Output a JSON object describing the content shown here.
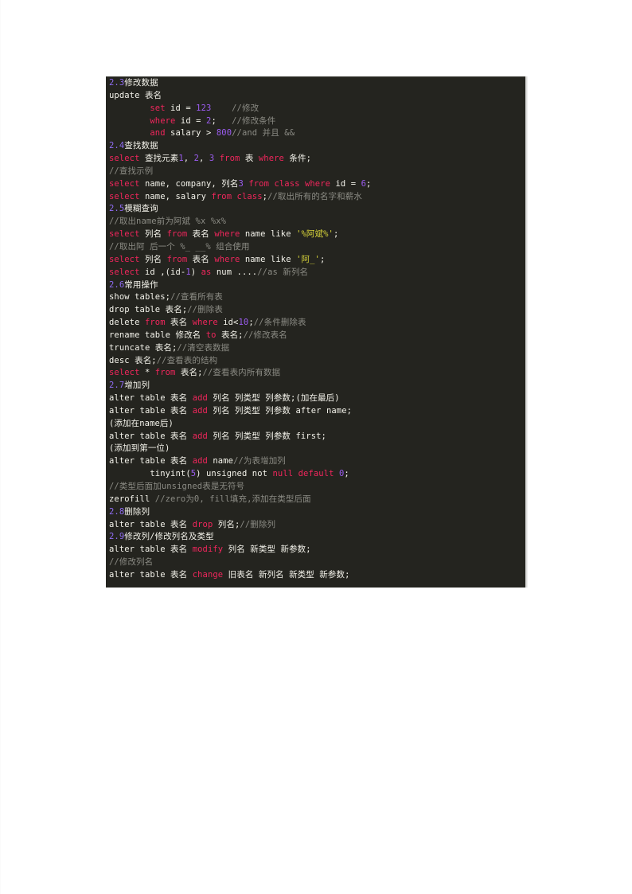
{
  "document": {
    "kind": "scanned-document-page",
    "background_color": "#ffffff",
    "code_block": {
      "background_color": "#24241f",
      "language": "sql",
      "colors": {
        "keyword": "#f0265c",
        "identifier": "#f3f2ea",
        "number": "#9b5cf0",
        "string": "#d6d23a",
        "comment": "#8b8b84",
        "section": "#8f6cf2"
      },
      "lines": [
        {
          "id": "l01",
          "tokens": [
            {
              "t": "2.3",
              "c": "sec"
            },
            {
              "t": "修改数据",
              "c": "id"
            }
          ]
        },
        {
          "id": "l02",
          "tokens": [
            {
              "t": "update",
              "c": "id"
            },
            {
              "t": " 表名",
              "c": "id"
            }
          ]
        },
        {
          "id": "l03",
          "tokens": [
            {
              "t": "        ",
              "c": "op"
            },
            {
              "t": "set",
              "c": "kw"
            },
            {
              "t": " id ",
              "c": "id"
            },
            {
              "t": "=",
              "c": "id"
            },
            {
              "t": " ",
              "c": "id"
            },
            {
              "t": "123",
              "c": "num"
            },
            {
              "t": "    ",
              "c": "op"
            },
            {
              "t": "//修改",
              "c": "cmt"
            }
          ]
        },
        {
          "id": "l04",
          "tokens": [
            {
              "t": "        ",
              "c": "op"
            },
            {
              "t": "where",
              "c": "kw"
            },
            {
              "t": " id ",
              "c": "id"
            },
            {
              "t": "=",
              "c": "id"
            },
            {
              "t": " ",
              "c": "id"
            },
            {
              "t": "2",
              "c": "num"
            },
            {
              "t": ";",
              "c": "id"
            },
            {
              "t": "   ",
              "c": "op"
            },
            {
              "t": "//修改条件",
              "c": "cmt"
            }
          ]
        },
        {
          "id": "l05",
          "tokens": [
            {
              "t": "        ",
              "c": "op"
            },
            {
              "t": "and",
              "c": "kw"
            },
            {
              "t": " salary ",
              "c": "id"
            },
            {
              "t": ">",
              "c": "id"
            },
            {
              "t": " ",
              "c": "id"
            },
            {
              "t": "800",
              "c": "num"
            },
            {
              "t": "//and 并且 &&",
              "c": "cmt"
            }
          ]
        },
        {
          "id": "l06",
          "tokens": [
            {
              "t": "2.4",
              "c": "sec"
            },
            {
              "t": "查找数据",
              "c": "id"
            }
          ]
        },
        {
          "id": "l07",
          "tokens": [
            {
              "t": "select",
              "c": "kw"
            },
            {
              "t": " 查找元素",
              "c": "id"
            },
            {
              "t": "1",
              "c": "num"
            },
            {
              "t": ", ",
              "c": "id"
            },
            {
              "t": "2",
              "c": "num"
            },
            {
              "t": ", ",
              "c": "id"
            },
            {
              "t": "3",
              "c": "num"
            },
            {
              "t": " ",
              "c": "id"
            },
            {
              "t": "from",
              "c": "kw"
            },
            {
              "t": " 表 ",
              "c": "id"
            },
            {
              "t": "where",
              "c": "kw"
            },
            {
              "t": " 条件;",
              "c": "id"
            }
          ]
        },
        {
          "id": "l08",
          "tokens": [
            {
              "t": "//查找示例",
              "c": "cmt"
            }
          ]
        },
        {
          "id": "l09",
          "tokens": [
            {
              "t": "select",
              "c": "kw"
            },
            {
              "t": " name, company, 列名",
              "c": "id"
            },
            {
              "t": "3",
              "c": "num"
            },
            {
              "t": " ",
              "c": "id"
            },
            {
              "t": "from",
              "c": "kw"
            },
            {
              "t": " ",
              "c": "id"
            },
            {
              "t": "class",
              "c": "kw"
            },
            {
              "t": " ",
              "c": "id"
            },
            {
              "t": "where",
              "c": "kw"
            },
            {
              "t": " id = ",
              "c": "id"
            },
            {
              "t": "6",
              "c": "num"
            },
            {
              "t": ";",
              "c": "id"
            }
          ]
        },
        {
          "id": "l10",
          "tokens": [
            {
              "t": "select",
              "c": "kw"
            },
            {
              "t": " name, salary ",
              "c": "id"
            },
            {
              "t": "from",
              "c": "kw"
            },
            {
              "t": " ",
              "c": "id"
            },
            {
              "t": "class",
              "c": "kw"
            },
            {
              "t": ";",
              "c": "id"
            },
            {
              "t": "//取出所有的名字和薪水",
              "c": "cmt"
            }
          ]
        },
        {
          "id": "l11",
          "tokens": [
            {
              "t": "2.5",
              "c": "sec"
            },
            {
              "t": "模糊查询",
              "c": "id"
            }
          ]
        },
        {
          "id": "l12",
          "tokens": [
            {
              "t": "//取出name前为阿斌 %x %x%",
              "c": "cmt"
            }
          ]
        },
        {
          "id": "l13",
          "tokens": [
            {
              "t": "select",
              "c": "kw"
            },
            {
              "t": " 列名 ",
              "c": "id"
            },
            {
              "t": "from",
              "c": "kw"
            },
            {
              "t": " 表名 ",
              "c": "id"
            },
            {
              "t": "where",
              "c": "kw"
            },
            {
              "t": " name like ",
              "c": "id"
            },
            {
              "t": "'%阿斌%'",
              "c": "str"
            },
            {
              "t": ";",
              "c": "id"
            }
          ]
        },
        {
          "id": "l14",
          "tokens": [
            {
              "t": "//取出阿 后一个 %_ __% 组合使用",
              "c": "cmt"
            }
          ]
        },
        {
          "id": "l15",
          "tokens": [
            {
              "t": "select",
              "c": "kw"
            },
            {
              "t": " 列名 ",
              "c": "id"
            },
            {
              "t": "from",
              "c": "kw"
            },
            {
              "t": " 表名 ",
              "c": "id"
            },
            {
              "t": "where",
              "c": "kw"
            },
            {
              "t": " name like ",
              "c": "id"
            },
            {
              "t": "'阿_'",
              "c": "str"
            },
            {
              "t": ";",
              "c": "id"
            }
          ]
        },
        {
          "id": "l16",
          "tokens": [
            {
              "t": "select",
              "c": "kw"
            },
            {
              "t": " id ,(id-",
              "c": "id"
            },
            {
              "t": "1",
              "c": "num"
            },
            {
              "t": ") ",
              "c": "id"
            },
            {
              "t": "as",
              "c": "kw"
            },
            {
              "t": " num ....",
              "c": "id"
            },
            {
              "t": "//as 新列名",
              "c": "cmt"
            }
          ]
        },
        {
          "id": "l17",
          "tokens": [
            {
              "t": "2.6",
              "c": "sec"
            },
            {
              "t": "常用操作",
              "c": "id"
            }
          ]
        },
        {
          "id": "l18",
          "tokens": [
            {
              "t": "show tables;",
              "c": "id"
            },
            {
              "t": "//查看所有表",
              "c": "cmt"
            }
          ]
        },
        {
          "id": "l19",
          "tokens": [
            {
              "t": "drop table 表名;",
              "c": "id"
            },
            {
              "t": "//删除表",
              "c": "cmt"
            }
          ]
        },
        {
          "id": "l20",
          "tokens": [
            {
              "t": "delete",
              "c": "id"
            },
            {
              "t": " ",
              "c": "id"
            },
            {
              "t": "from",
              "c": "kw"
            },
            {
              "t": " 表名 ",
              "c": "id"
            },
            {
              "t": "where",
              "c": "kw"
            },
            {
              "t": " id<",
              "c": "id"
            },
            {
              "t": "10",
              "c": "num"
            },
            {
              "t": ";",
              "c": "id"
            },
            {
              "t": "//条件删除表",
              "c": "cmt"
            }
          ]
        },
        {
          "id": "l21",
          "tokens": [
            {
              "t": "rename table 修改名 ",
              "c": "id"
            },
            {
              "t": "to",
              "c": "kw"
            },
            {
              "t": " 表名;",
              "c": "id"
            },
            {
              "t": "//修改表名",
              "c": "cmt"
            }
          ]
        },
        {
          "id": "l22",
          "tokens": [
            {
              "t": "truncate 表名;",
              "c": "id"
            },
            {
              "t": "//清空表数据",
              "c": "cmt"
            }
          ]
        },
        {
          "id": "l23",
          "tokens": [
            {
              "t": "desc 表名;",
              "c": "id"
            },
            {
              "t": "//查看表的结构",
              "c": "cmt"
            }
          ]
        },
        {
          "id": "l24",
          "tokens": [
            {
              "t": "select",
              "c": "kw"
            },
            {
              "t": " * ",
              "c": "id"
            },
            {
              "t": "from",
              "c": "kw"
            },
            {
              "t": " 表名;",
              "c": "id"
            },
            {
              "t": "//查看表内所有数据",
              "c": "cmt"
            }
          ]
        },
        {
          "id": "l25",
          "tokens": [
            {
              "t": "2.7",
              "c": "sec"
            },
            {
              "t": "增加列",
              "c": "id"
            }
          ]
        },
        {
          "id": "l26",
          "tokens": [
            {
              "t": "alter table 表名 ",
              "c": "id"
            },
            {
              "t": "add",
              "c": "kw"
            },
            {
              "t": " 列名 列类型 列参数;(加在最后)",
              "c": "id"
            }
          ]
        },
        {
          "id": "l27",
          "tokens": [
            {
              "t": "alter table 表名 ",
              "c": "id"
            },
            {
              "t": "add",
              "c": "kw"
            },
            {
              "t": " 列名 列类型 列参数 after name;",
              "c": "id"
            }
          ]
        },
        {
          "id": "l28",
          "tokens": [
            {
              "t": "(添加在name后)",
              "c": "id"
            }
          ]
        },
        {
          "id": "l29",
          "tokens": [
            {
              "t": "alter table 表名 ",
              "c": "id"
            },
            {
              "t": "add",
              "c": "kw"
            },
            {
              "t": " 列名 列类型 列参数 first;",
              "c": "id"
            }
          ]
        },
        {
          "id": "l30",
          "tokens": [
            {
              "t": "(添加到第一位)",
              "c": "id"
            }
          ]
        },
        {
          "id": "l31",
          "tokens": [
            {
              "t": "alter table 表名 ",
              "c": "id"
            },
            {
              "t": "add",
              "c": "kw"
            },
            {
              "t": " name",
              "c": "id"
            },
            {
              "t": "//为表增加列",
              "c": "cmt"
            }
          ]
        },
        {
          "id": "l32",
          "tokens": [
            {
              "t": "        tinyint(",
              "c": "id"
            },
            {
              "t": "5",
              "c": "num"
            },
            {
              "t": ") unsigned not ",
              "c": "id"
            },
            {
              "t": "null",
              "c": "kw"
            },
            {
              "t": " ",
              "c": "id"
            },
            {
              "t": "default",
              "c": "kw"
            },
            {
              "t": " ",
              "c": "id"
            },
            {
              "t": "0",
              "c": "num"
            },
            {
              "t": ";",
              "c": "id"
            }
          ]
        },
        {
          "id": "l33",
          "tokens": [
            {
              "t": "//类型后面加unsigned表是无符号",
              "c": "cmt"
            }
          ]
        },
        {
          "id": "l34",
          "tokens": [
            {
              "t": "zerofill",
              "c": "id"
            },
            {
              "t": " //zero为0, fill填充,添加在类型后面",
              "c": "cmt"
            }
          ]
        },
        {
          "id": "l35",
          "tokens": [
            {
              "t": "2.8",
              "c": "sec"
            },
            {
              "t": "删除列",
              "c": "id"
            }
          ]
        },
        {
          "id": "l36",
          "tokens": [
            {
              "t": "alter table 表名 ",
              "c": "id"
            },
            {
              "t": "drop",
              "c": "kw"
            },
            {
              "t": " 列名;",
              "c": "id"
            },
            {
              "t": "//删除列",
              "c": "cmt"
            }
          ]
        },
        {
          "id": "l37",
          "tokens": [
            {
              "t": "2.9",
              "c": "sec"
            },
            {
              "t": "修改列/修改列名及类型",
              "c": "id"
            }
          ]
        },
        {
          "id": "l38",
          "tokens": [
            {
              "t": "alter table 表名 ",
              "c": "id"
            },
            {
              "t": "modify",
              "c": "kw"
            },
            {
              "t": " 列名 新类型 新参数;",
              "c": "id"
            }
          ]
        },
        {
          "id": "l39",
          "tokens": [
            {
              "t": "//修改列名",
              "c": "cmt"
            }
          ]
        },
        {
          "id": "l40",
          "tokens": [
            {
              "t": "alter table 表名 ",
              "c": "id"
            },
            {
              "t": "change",
              "c": "kw"
            },
            {
              "t": " 旧表名 新列名 新类型 新参数;",
              "c": "id"
            }
          ]
        }
      ]
    }
  }
}
